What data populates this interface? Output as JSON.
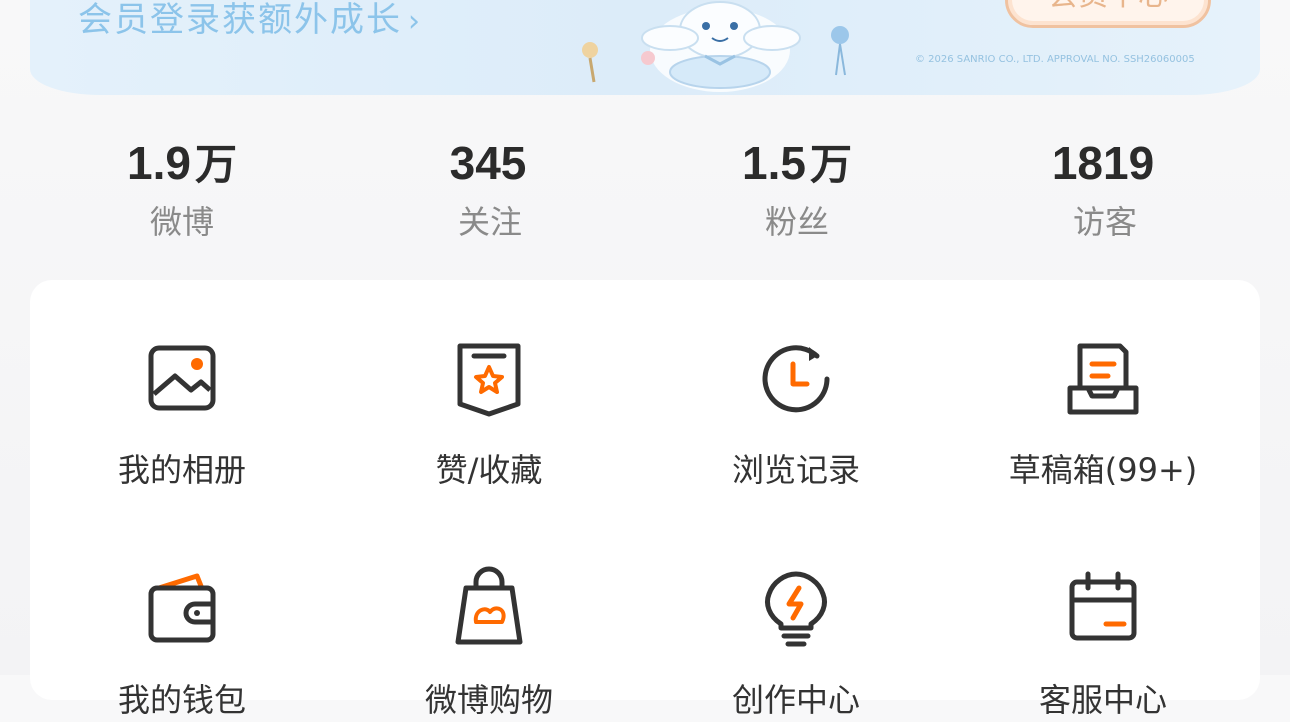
{
  "banner": {
    "promo_text": "会员登录获额外成长",
    "button_label": "会员中心",
    "copyright": "© 2026 SANRIO CO., LTD.  APPROVAL NO. SSH26060005"
  },
  "stats": [
    {
      "value": "1.9",
      "unit": "万",
      "label": "微博"
    },
    {
      "value": "345",
      "unit": "",
      "label": "关注"
    },
    {
      "value": "1.5",
      "unit": "万",
      "label": "粉丝"
    },
    {
      "value": "1819",
      "unit": "",
      "label": "访客"
    }
  ],
  "menu": {
    "row1": [
      {
        "label": "我的相册",
        "icon": "photo-album-icon"
      },
      {
        "label": "赞/收藏",
        "icon": "bookmark-star-icon"
      },
      {
        "label": "浏览记录",
        "icon": "history-clock-icon"
      },
      {
        "label": "草稿箱(99+)",
        "icon": "draft-tray-icon"
      }
    ],
    "row2": [
      {
        "label": "我的钱包",
        "icon": "wallet-icon"
      },
      {
        "label": "微博购物",
        "icon": "shopping-bag-icon"
      },
      {
        "label": "创作中心",
        "icon": "lightbulb-icon"
      },
      {
        "label": "客服中心",
        "icon": "calendar-icon"
      }
    ]
  },
  "colors": {
    "accent": "#ff6a00",
    "icon_stroke": "#333333",
    "banner_text": "#8cc4ea"
  }
}
